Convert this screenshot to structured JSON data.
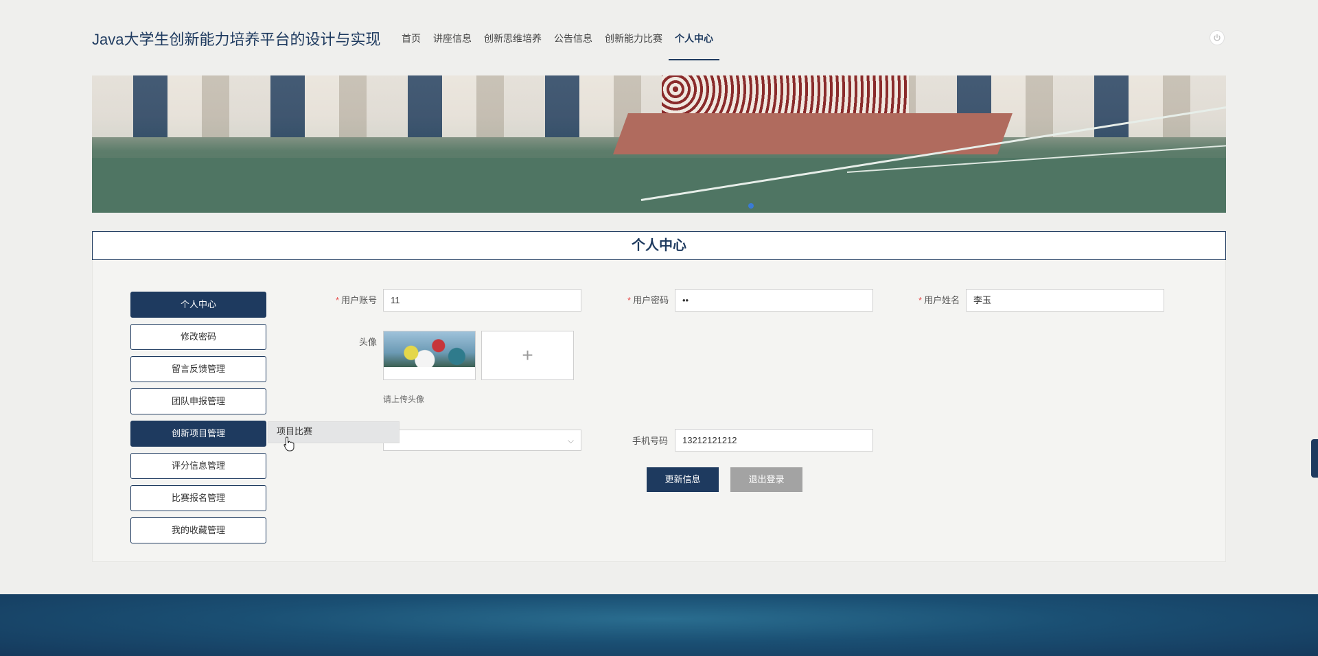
{
  "header": {
    "title": "Java大学生创新能力培养平台的设计与实现",
    "nav": [
      {
        "label": "首页"
      },
      {
        "label": "讲座信息"
      },
      {
        "label": "创新思维培养"
      },
      {
        "label": "公告信息"
      },
      {
        "label": "创新能力比赛"
      },
      {
        "label": "个人中心"
      }
    ],
    "active_nav": "个人中心",
    "power_icon": "power-icon"
  },
  "section": {
    "title": "个人中心"
  },
  "sidebar": {
    "items": [
      {
        "label": "个人中心"
      },
      {
        "label": "修改密码"
      },
      {
        "label": "留言反馈管理"
      },
      {
        "label": "团队申报管理"
      },
      {
        "label": "创新项目管理"
      },
      {
        "label": "评分信息管理"
      },
      {
        "label": "比赛报名管理"
      },
      {
        "label": "我的收藏管理"
      }
    ],
    "active": [
      "个人中心",
      "创新项目管理"
    ],
    "flyout": {
      "label": "项目比赛"
    }
  },
  "form": {
    "account": {
      "label": "用户账号",
      "value": "11"
    },
    "password": {
      "label": "用户密码",
      "value": "••"
    },
    "name": {
      "label": "用户姓名",
      "value": "李玉"
    },
    "avatar": {
      "label": "头像",
      "hint": "请上传头像",
      "upload_symbol": "+"
    },
    "phone": {
      "label": "手机号码",
      "value": "13212121212"
    },
    "required_mark": "*",
    "select_chevron": "⌵"
  },
  "buttons": {
    "update": "更新信息",
    "logout": "退出登录"
  },
  "colors": {
    "primary": "#1e3a5f",
    "gray_button": "#a3a3a3",
    "required": "#e64c4c"
  }
}
